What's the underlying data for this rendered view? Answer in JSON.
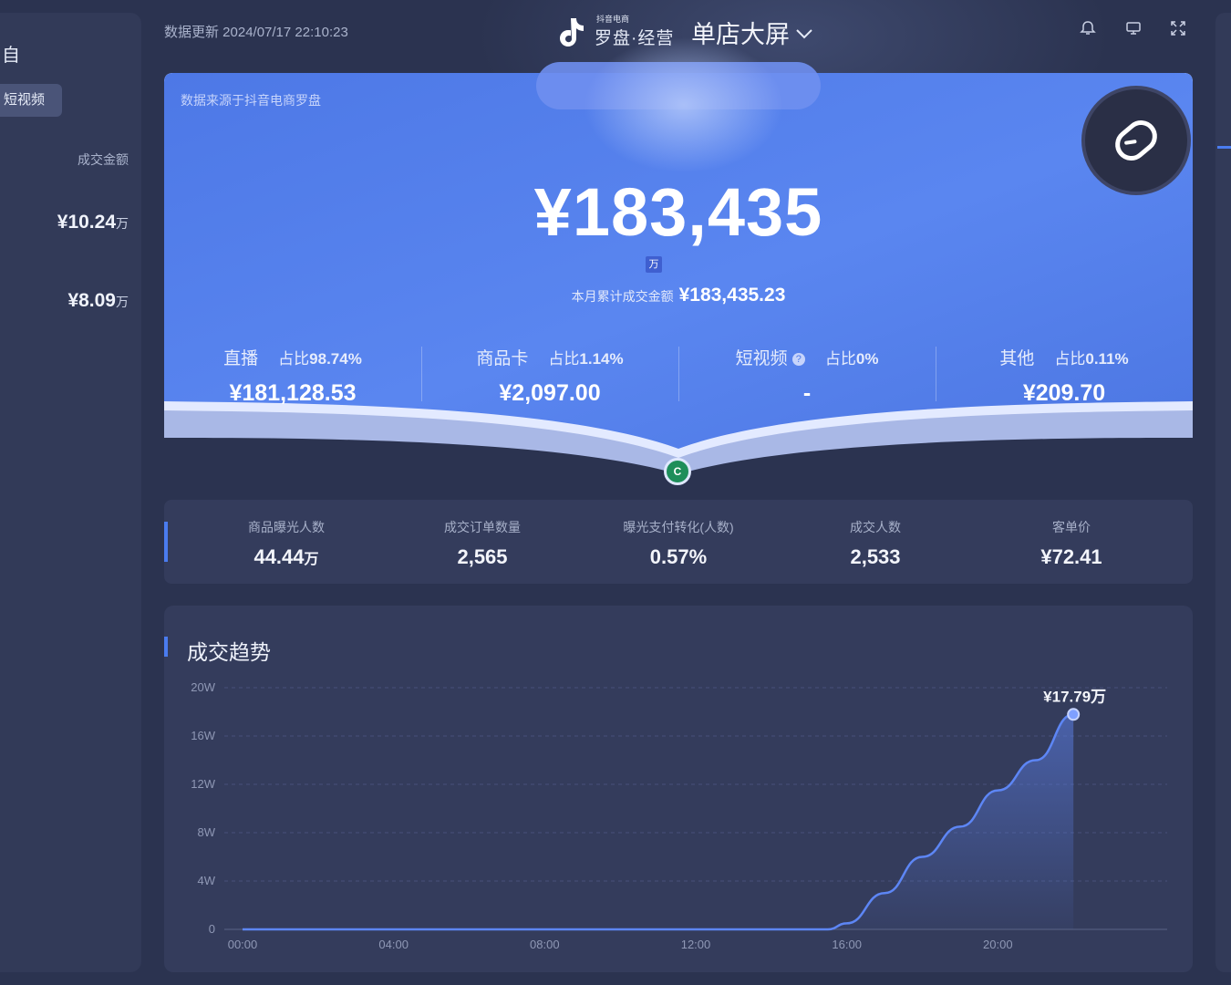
{
  "header": {
    "update_label": "数据更新 2024/07/17 22:10:23",
    "brand_sub": "抖音电商",
    "brand_name": "罗盘·经营",
    "page_title": "单店大屏"
  },
  "left_panel": {
    "edge_char": "自",
    "tab_label": "短视频",
    "column_header": "成交金额",
    "rows": [
      {
        "value": "¥10.24",
        "unit": "万"
      },
      {
        "value": "¥8.09",
        "unit": "万"
      }
    ]
  },
  "hero": {
    "source_note": "数据来源于抖音电商罗盘",
    "total": "¥183,435",
    "total_unit": "万",
    "cumulative_label": "本月累计成交金额",
    "cumulative_value": "¥183,435.23",
    "channels": [
      {
        "name": "直播",
        "share_label": "占比",
        "share": "98.74%",
        "value": "¥181,128.53",
        "has_help": false
      },
      {
        "name": "商品卡",
        "share_label": "占比",
        "share": "1.14%",
        "value": "¥2,097.00",
        "has_help": false
      },
      {
        "name": "短视频",
        "share_label": "占比",
        "share": "0%",
        "value": "-",
        "has_help": true
      },
      {
        "name": "其他",
        "share_label": "占比",
        "share": "0.11%",
        "value": "¥209.70",
        "has_help": false
      }
    ]
  },
  "metrics": [
    {
      "label": "商品曝光人数",
      "value": "44.44",
      "unit": "万"
    },
    {
      "label": "成交订单数量",
      "value": "2,565",
      "unit": ""
    },
    {
      "label": "曝光支付转化(人数)",
      "value": "0.57%",
      "unit": ""
    },
    {
      "label": "成交人数",
      "value": "2,533",
      "unit": ""
    },
    {
      "label": "客单价",
      "value": "¥72.41",
      "unit": ""
    }
  ],
  "trend": {
    "title": "成交趋势",
    "end_label": "¥17.79万"
  },
  "colors": {
    "background": "#2b3350",
    "hero_blue": "#4f7ae8",
    "accent": "#4a7cf0",
    "card": "#343c5c"
  },
  "icons": {
    "bell": "bell-icon",
    "screen": "monitor-icon",
    "fullscreen": "fullscreen-icon",
    "mouse": "mouse-icon"
  },
  "chart_data": {
    "type": "area",
    "title": "成交趋势",
    "xlabel": "",
    "ylabel": "",
    "x_ticks": [
      "00:00",
      "04:00",
      "08:00",
      "12:00",
      "16:00",
      "20:00"
    ],
    "y_ticks": [
      "0",
      "4W",
      "8W",
      "12W",
      "16W",
      "20W"
    ],
    "x_range_hours": [
      0,
      24
    ],
    "ylim": [
      0,
      200000
    ],
    "grid": true,
    "series": [
      {
        "x": [
          0,
          4,
          8,
          12,
          15.5,
          16,
          17,
          18,
          19,
          20,
          21,
          22
        ],
        "y": [
          0,
          0,
          0,
          0,
          0,
          5000,
          30000,
          60000,
          85000,
          115000,
          140000,
          177900
        ]
      }
    ],
    "annotations": [
      {
        "x": 22,
        "y": 177900,
        "text": "¥17.79万"
      }
    ]
  }
}
